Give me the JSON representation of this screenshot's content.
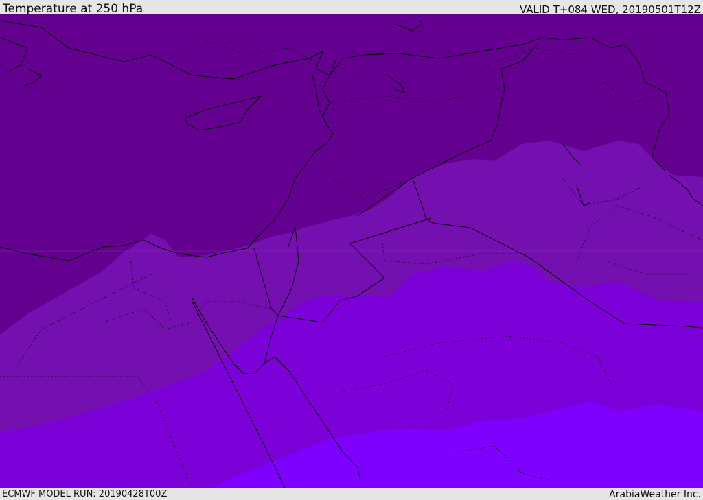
{
  "header": {
    "title": "Temperature at 250 hPa",
    "valid_time": "VALID T+084 WED, 20190501T12Z"
  },
  "footer": {
    "model_run": "ECMWF MODEL RUN: 20190428T00Z",
    "credit": "ArabiaWeather Inc."
  },
  "colors": {
    "coldest_band": "#64008f",
    "cold_band": "#7410b0",
    "mid_band": "#7c00d8",
    "warm_band": "#7e00fe",
    "borders": "#000000"
  }
}
